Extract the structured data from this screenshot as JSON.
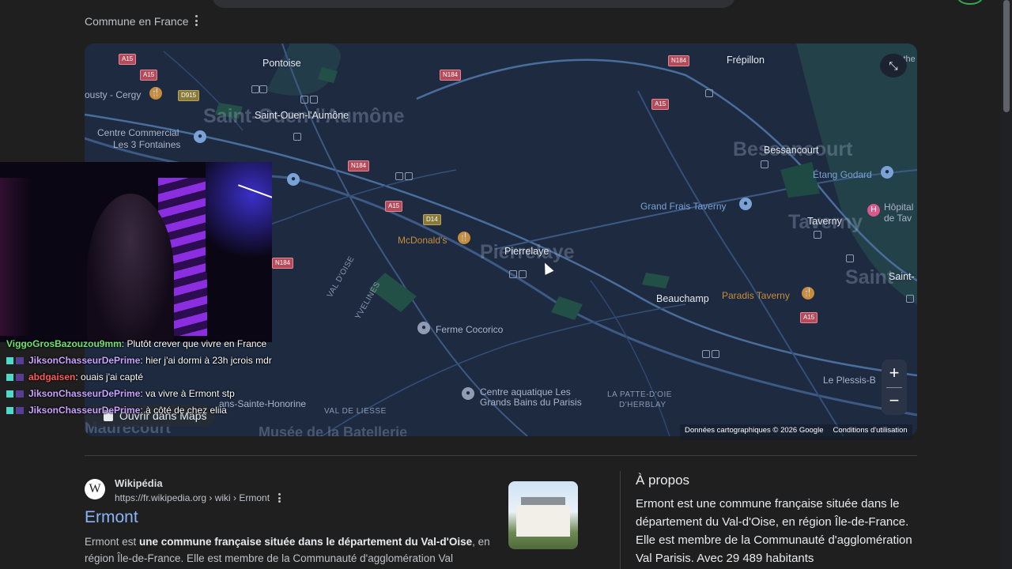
{
  "header": {
    "section_label": "Commune en France"
  },
  "map": {
    "big_labels": [
      "Saint-Ouen-l'Aumône",
      "Pierrelaye",
      "Bessancourt",
      "Taverny",
      "Saint-"
    ],
    "cities": [
      "Pontoise",
      "Saint-Ouen-l'Aumône",
      "Pierrelaye",
      "Bessancourt",
      "Taverny",
      "Beauchamp",
      "Frépillon",
      "Saint-"
    ],
    "places": [
      "ousty - Cergy",
      "Centre Commercial",
      "Les 3 Fontaines",
      "McDonald's",
      "Grand Frais Taverny",
      "Étang Godard",
      "Hôpital",
      "de Tav",
      "Paradis Taverny",
      "Ferme Cocorico",
      "Centre aquatique Les",
      "Grands Bains du Parisis",
      "Le Plessis-B",
      "ans-Sainte-Honorine",
      "Musée de la Batellerie",
      "Maurecourt",
      "Bethe"
    ],
    "areas": [
      "VAL D'OISE",
      "YVELINES",
      "VAL DE LIESSE",
      "LA PATTE-D'OIE",
      "D'HERBLAY"
    ],
    "roads": [
      "A15",
      "A15",
      "D915",
      "N184",
      "N184",
      "N184",
      "A15",
      "D14",
      "N184",
      "A15",
      "A15"
    ],
    "attribution": "Données cartographiques © 2026 Google",
    "terms": "Conditions d'utilisation",
    "zoom_in": "+",
    "zoom_out": "−",
    "open_maps_label": "Ouvrir dans Maps"
  },
  "chat": [
    {
      "user": "ViggoGrosBazouzou9mm",
      "message": "Plutôt crever que vivre en France",
      "color": "#6ee36e"
    },
    {
      "user": "JiksonChasseurDePrime",
      "message": "hier j'ai dormi à 23h jcrois mdr",
      "color": "#c9a3ff"
    },
    {
      "user": "abdgaisen",
      "message": "ouais j'ai capté",
      "color": "#ff5a5a"
    },
    {
      "user": "JiksonChasseurDePrime",
      "message": "va vivre à Ermont stp",
      "color": "#c9a3ff"
    },
    {
      "user": "JiksonChasseurDePrime",
      "message": "à côté de chez eliia",
      "color": "#c9a3ff"
    }
  ],
  "result": {
    "source_name": "Wikipédia",
    "source_url": "https://fr.wikipedia.org › wiki › Ermont",
    "logo_letter": "W",
    "title": "Ermont",
    "snippet_start": "Ermont est ",
    "snippet_bold": "une commune française située dans le département du Val-d'Oise",
    "snippet_end": ", en région Île-de-France. Elle est membre de la Communauté d'agglomération Val"
  },
  "about": {
    "title": "À propos",
    "text": "Ermont est une commune française située dans le département du Val-d'Oise, en région Île-de-France. Elle est membre de la Communauté d'agglomération Val Parisis. Avec 29 489 habitants"
  }
}
